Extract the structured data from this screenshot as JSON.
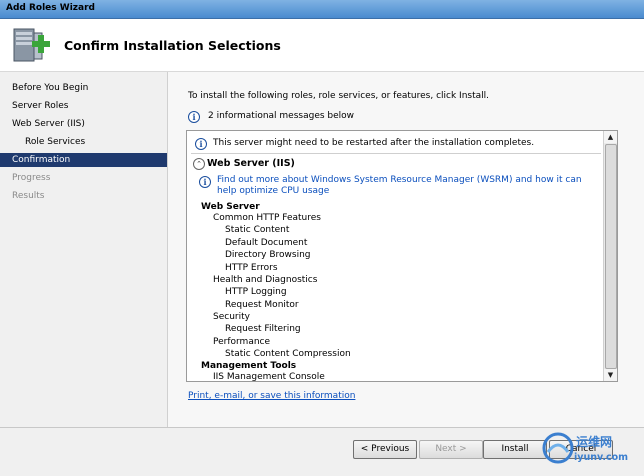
{
  "window": {
    "title": "Add Roles Wizard"
  },
  "header": {
    "page_title": "Confirm Installation Selections",
    "icon": "server-add-icon"
  },
  "nav": {
    "items": [
      {
        "label": "Before You Begin",
        "state": "normal",
        "level": 0
      },
      {
        "label": "Server Roles",
        "state": "normal",
        "level": 0
      },
      {
        "label": "Web Server (IIS)",
        "state": "normal",
        "level": 0
      },
      {
        "label": "Role Services",
        "state": "normal",
        "level": 1
      },
      {
        "label": "Confirmation",
        "state": "active",
        "level": 0
      },
      {
        "label": "Progress",
        "state": "disabled",
        "level": 0
      },
      {
        "label": "Results",
        "state": "disabled",
        "level": 0
      }
    ]
  },
  "content": {
    "intro": "To install the following roles, role services, or features, click Install.",
    "info_summary": "2 informational messages below",
    "restart_note": "This server might need to be restarted after the installation completes.",
    "section_title": "Web Server (IIS)",
    "wsrm_link": "Find out more about Windows System Resource Manager (WSRM) and how it can help optimize CPU usage",
    "tree": [
      {
        "text": "Web Server",
        "level": 0
      },
      {
        "text": "Common HTTP Features",
        "level": 1
      },
      {
        "text": "Static Content",
        "level": 2
      },
      {
        "text": "Default Document",
        "level": 2
      },
      {
        "text": "Directory Browsing",
        "level": 2
      },
      {
        "text": "HTTP Errors",
        "level": 2
      },
      {
        "text": "Health and Diagnostics",
        "level": 1
      },
      {
        "text": "HTTP Logging",
        "level": 2
      },
      {
        "text": "Request Monitor",
        "level": 2
      },
      {
        "text": "Security",
        "level": 1
      },
      {
        "text": "Request Filtering",
        "level": 2
      },
      {
        "text": "Performance",
        "level": 1
      },
      {
        "text": "Static Content Compression",
        "level": 2
      },
      {
        "text": "Management Tools",
        "level": 0
      },
      {
        "text": "IIS Management Console",
        "level": 1
      }
    ],
    "print_link": "Print, e-mail, or save this information"
  },
  "buttons": {
    "previous": "< Previous",
    "next": "Next >",
    "install": "Install",
    "cancel": "Cancel"
  },
  "watermark": {
    "cn": "运维网",
    "url": "iyunv.com"
  },
  "colors": {
    "nav_active_bg": "#1f3a6e",
    "link": "#0b4fbd",
    "titlebar": "#4a8bcf"
  }
}
